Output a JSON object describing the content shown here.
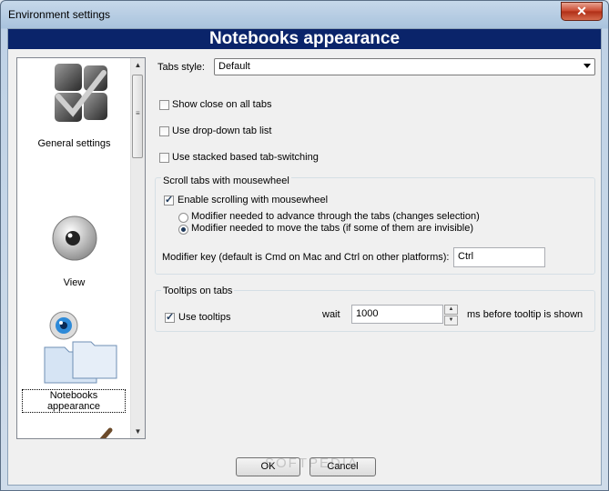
{
  "window": {
    "title": "Environment settings",
    "close_glyph": "✕"
  },
  "header": {
    "title": "Notebooks appearance"
  },
  "sidebar": {
    "items": [
      {
        "label": "General settings",
        "icon": "general-settings-icon"
      },
      {
        "label": "View",
        "icon": "view-eye-icon"
      },
      {
        "label": "Notebooks appearance",
        "icon": "notebooks-folders-icon"
      },
      {
        "label": "",
        "icon": "editor-folder-brush-icon"
      }
    ]
  },
  "tabs_style": {
    "label": "Tabs style:",
    "value": "Default"
  },
  "checks": [
    {
      "label": "Show close on all tabs",
      "checked": false
    },
    {
      "label": "Use drop-down tab list",
      "checked": false
    },
    {
      "label": "Use stacked based tab-switching",
      "checked": false
    }
  ],
  "scroll_group": {
    "title": "Scroll tabs with mousewheel",
    "enable_label": "Enable scrolling with mousewheel",
    "enable_checked": true,
    "radio1": "Modifier needed to advance through the tabs (changes selection)",
    "radio2": "Modifier needed to move the tabs (if some of them are invisible)",
    "selected_radio": 2,
    "modifier_label": "Modifier key (default is Cmd on Mac and Ctrl on other platforms):",
    "modifier_value": "Ctrl"
  },
  "tooltips_group": {
    "title": "Tooltips on tabs",
    "use_label": "Use tooltips",
    "use_checked": true,
    "wait_label": "wait",
    "wait_value": "1000",
    "suffix": "ms before tooltip is shown"
  },
  "buttons": {
    "ok": "OK",
    "cancel": "Cancel"
  },
  "watermark": "SOFTPEDIA"
}
